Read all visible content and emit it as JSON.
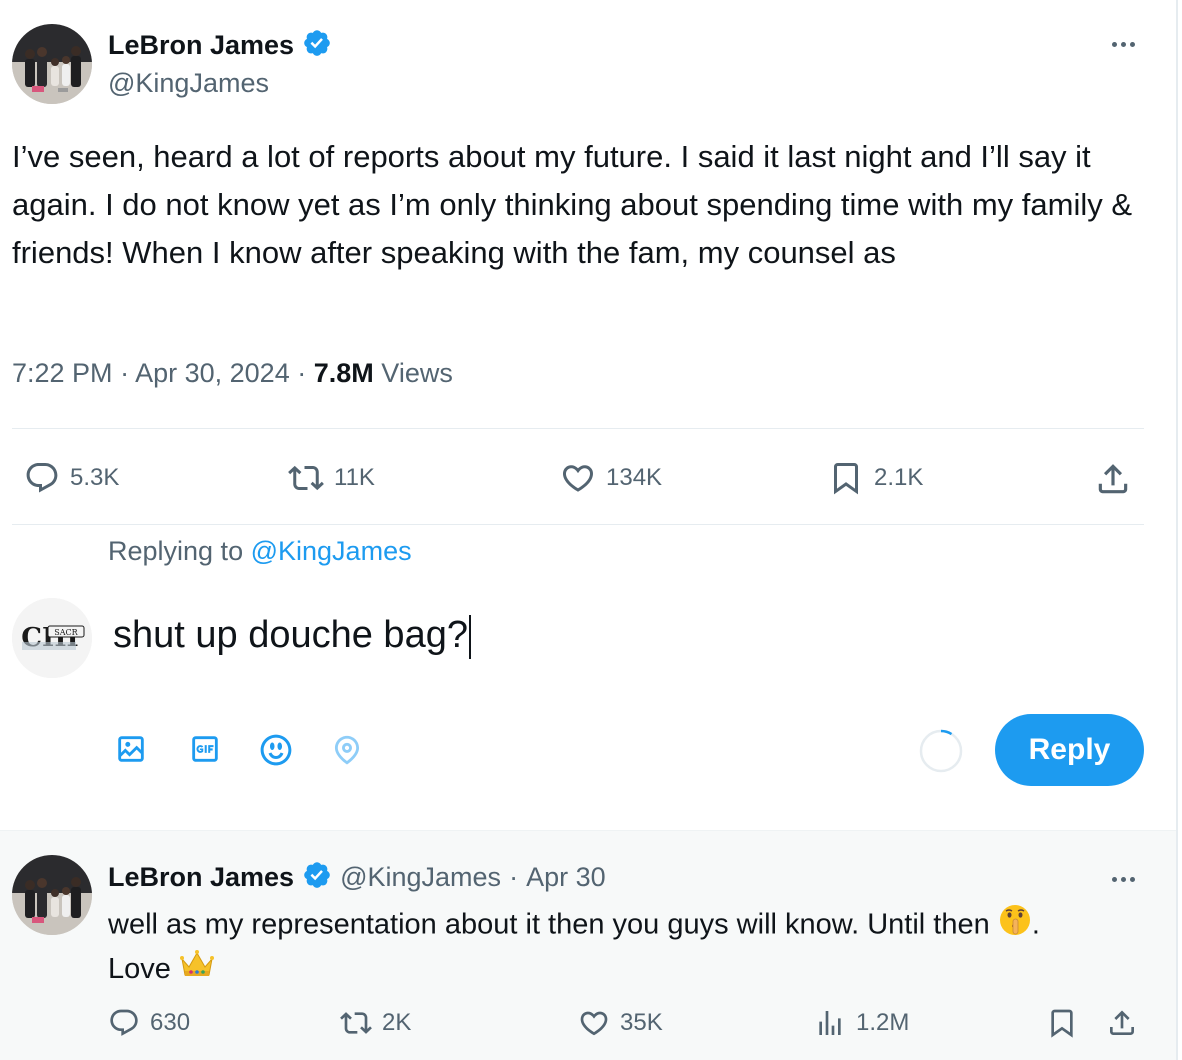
{
  "tweet": {
    "author_name": "LeBron James",
    "author_handle": "@KingJames",
    "text": "I’ve seen, heard a lot of reports about my future. I said it last night and I’ll say it again. I do not know yet as I’m only thinking about spending time with my family & friends! When I know after speaking with the fam, my counsel as",
    "time": "7:22 PM",
    "date": "Apr 30, 2024",
    "views_count": "7.8M",
    "views_label": "Views",
    "separator": "·",
    "stats": {
      "replies": "5.3K",
      "reposts": "11K",
      "likes": "134K",
      "bookmarks": "2.1K"
    }
  },
  "compose": {
    "replying_prefix": "Replying to",
    "replying_to": "@KingJames",
    "value": "shut up douche bag?",
    "submit_label": "Reply",
    "avatar_text": "CHI",
    "avatar_subtext": "SACR"
  },
  "reply": {
    "author_name": "LeBron James",
    "author_handle": "@KingJames",
    "date": "Apr 30",
    "separator": "·",
    "text_line1": "well as my representation about it then you guys will know. Until then",
    "text_after_emoji": ".",
    "text_line2": "Love",
    "emoji_1": "shushing-face-icon",
    "emoji_2": "crown-icon",
    "stats": {
      "replies": "630",
      "reposts": "2K",
      "likes": "35K",
      "views": "1.2M"
    }
  },
  "colors": {
    "accent": "#1d9bf0",
    "text": "#0f1419",
    "secondary": "#536471",
    "reply_bg": "#f7f9f9"
  }
}
